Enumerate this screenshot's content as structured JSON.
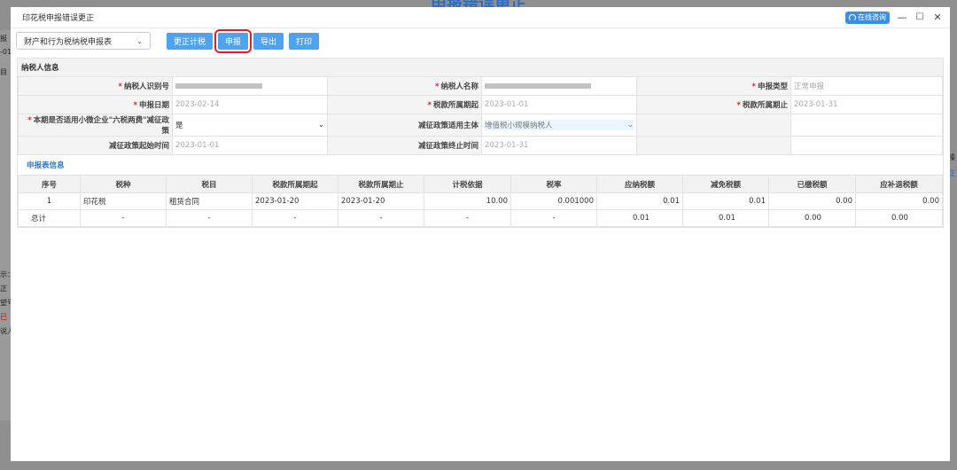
{
  "background": {
    "title": "申报错误更正",
    "left_fragments": [
      "报",
      "-01",
      "目",
      "示：",
      "正",
      "望号",
      "已",
      "说人"
    ],
    "right_fragments": [
      "操",
      "正"
    ]
  },
  "dialog": {
    "title": "印花税申报错误更正",
    "consult_label": "在线咨询",
    "controls": [
      "—",
      "☐",
      "✕"
    ]
  },
  "toolbar": {
    "report_type": "财产和行为税纳税申报表",
    "buttons": [
      "更正计税",
      "申报",
      "导出",
      "打印"
    ]
  },
  "taxpayer": {
    "section_title": "纳税人信息",
    "rows": [
      [
        {
          "label": "纳税人识别号",
          "required": true,
          "masked_width": 98
        },
        {
          "label": "纳税人名称",
          "required": true,
          "masked_width": 120
        },
        {
          "label": "申报类型",
          "required": true,
          "value": "正常申报"
        }
      ],
      [
        {
          "label": "申报日期",
          "required": true,
          "value": "2023-02-14"
        },
        {
          "label": "税款所属期起",
          "required": true,
          "value": "2023-01-01"
        },
        {
          "label": "税款所属期止",
          "required": true,
          "value": "2023-01-31"
        }
      ],
      [
        {
          "label": "本期是否适用小微企业\"六税两费\"减征政策",
          "required": true,
          "select": "是"
        },
        {
          "label": "减征政策适用主体",
          "required": false,
          "select": "增值税小规模纳税人"
        },
        {
          "label": "",
          "required": false,
          "value": ""
        }
      ],
      [
        {
          "label": "减征政策起始时间",
          "required": false,
          "value": "2023-01-01"
        },
        {
          "label": "减征政策终止时间",
          "required": false,
          "value": "2023-01-31"
        },
        {
          "label": "",
          "required": false,
          "value": ""
        }
      ]
    ]
  },
  "declaration": {
    "section_title": "申报表信息",
    "headers": [
      "序号",
      "税种",
      "税目",
      "税款所属期起",
      "税款所属期止",
      "计税依据",
      "税率",
      "应纳税额",
      "减免税额",
      "已缴税额",
      "应补退税额"
    ],
    "rows": [
      [
        "1",
        "印花税",
        "租赁合同",
        "2023-01-20",
        "2023-01-20",
        "10.00",
        "0.001000",
        "0.01",
        "0.01",
        "0.00",
        "0.00"
      ]
    ],
    "total": [
      "总计",
      "-",
      "-",
      "-",
      "-",
      "-",
      "-",
      "0.01",
      "0.01",
      "0.00",
      "0.00"
    ]
  }
}
